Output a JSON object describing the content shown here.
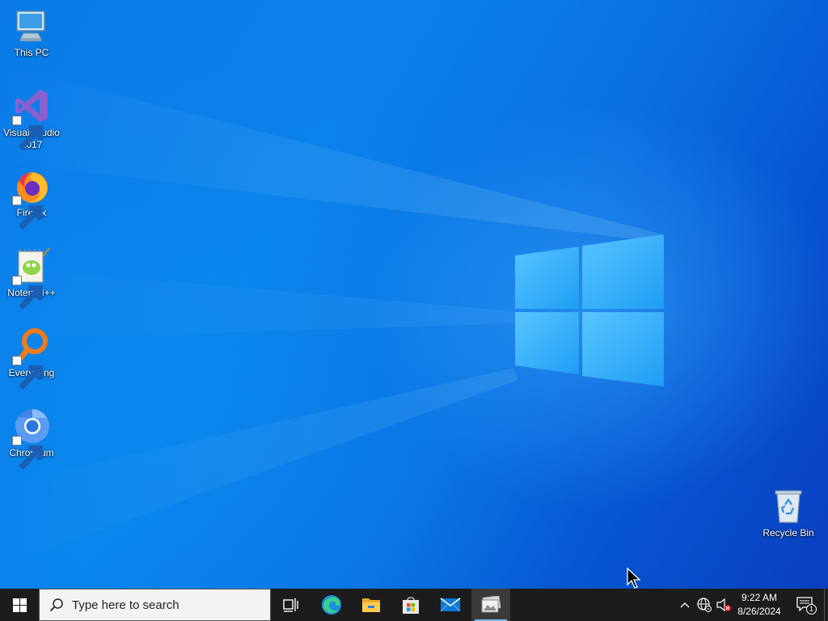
{
  "desktop": {
    "icons": [
      {
        "label": "This PC",
        "icon": "computer-icon"
      },
      {
        "label": "Visual Studio 2017",
        "label_line1": "Visual Studio",
        "label_line2": "2017",
        "icon": "visual-studio-icon"
      },
      {
        "label": "Firefox",
        "icon": "firefox-icon"
      },
      {
        "label": "Notepad++",
        "icon": "notepad-plus-plus-icon"
      },
      {
        "label": "Everything",
        "icon": "everything-search-icon"
      },
      {
        "label": "Chromium",
        "icon": "chromium-icon"
      },
      {
        "label": "Recycle Bin",
        "icon": "recycle-bin-icon"
      }
    ]
  },
  "taskbar": {
    "start_icon": "windows-start-icon",
    "search_placeholder": "Type here to search",
    "apps": [
      {
        "name": "Task View",
        "icon": "task-view-icon"
      },
      {
        "name": "Microsoft Edge",
        "icon": "edge-icon"
      },
      {
        "name": "File Explorer",
        "icon": "file-explorer-icon"
      },
      {
        "name": "Microsoft Store",
        "icon": "store-icon"
      },
      {
        "name": "Mail",
        "icon": "mail-icon"
      },
      {
        "name": "Photos",
        "icon": "photos-icon",
        "active": true
      }
    ],
    "tray": {
      "time": "9:22 AM",
      "date": "8/26/2024",
      "notification_count": "1"
    }
  },
  "colors": {
    "taskbar_bg": "#1c1c1c",
    "accent": "#76b9ed",
    "desktop_blue": "#0a7be8"
  }
}
